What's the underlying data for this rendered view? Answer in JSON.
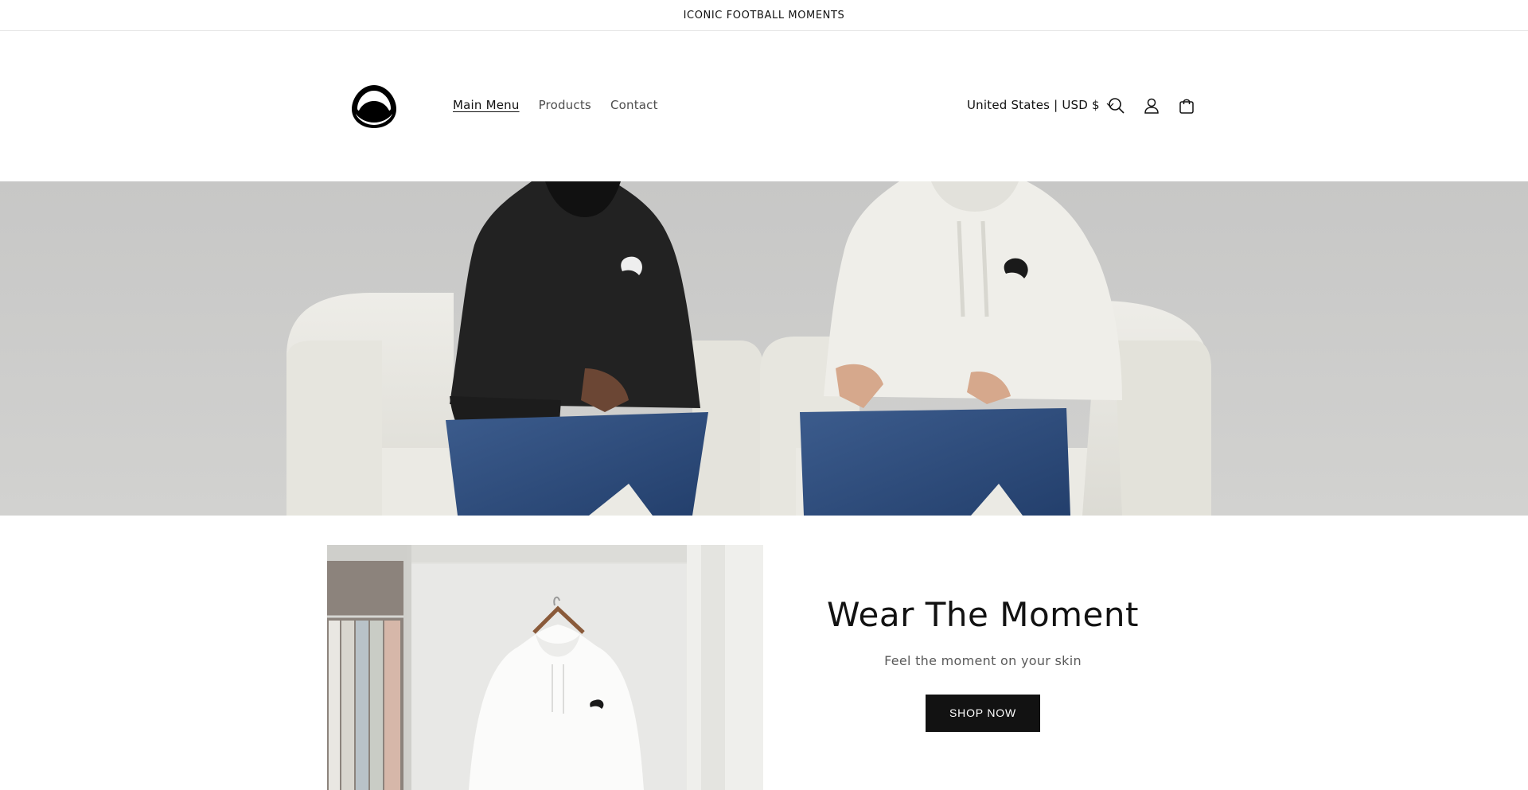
{
  "announcement": {
    "text": "ICONIC FOOTBALL MOMENTS"
  },
  "header": {
    "logo_icon": "brand-logo",
    "nav": [
      {
        "label": "Main Menu",
        "active": true
      },
      {
        "label": "Products",
        "active": false
      },
      {
        "label": "Contact",
        "active": false
      }
    ],
    "country_selector": {
      "value": "United States | USD $",
      "icon": "chevron-down-icon"
    },
    "icons": [
      "search-icon",
      "account-icon",
      "cart-icon"
    ]
  },
  "hero": {
    "image": "two models in black and white hoodies seated on white armchairs",
    "colors": {
      "backdrop": "#cbcbca",
      "chair": "#e9e8e2",
      "hoodie_dark": "#232323",
      "hoodie_light": "#f0efea",
      "denim": "#2f4d7e"
    }
  },
  "feature": {
    "image": "white hoodie hanging on wardrobe door",
    "title": "Wear The Moment",
    "subtitle": "Feel the moment on your skin",
    "button_label": "SHOP NOW"
  },
  "colors": {
    "accent": "#121212",
    "text_muted": "#5a5a5a",
    "border": "#e6e6e6"
  }
}
